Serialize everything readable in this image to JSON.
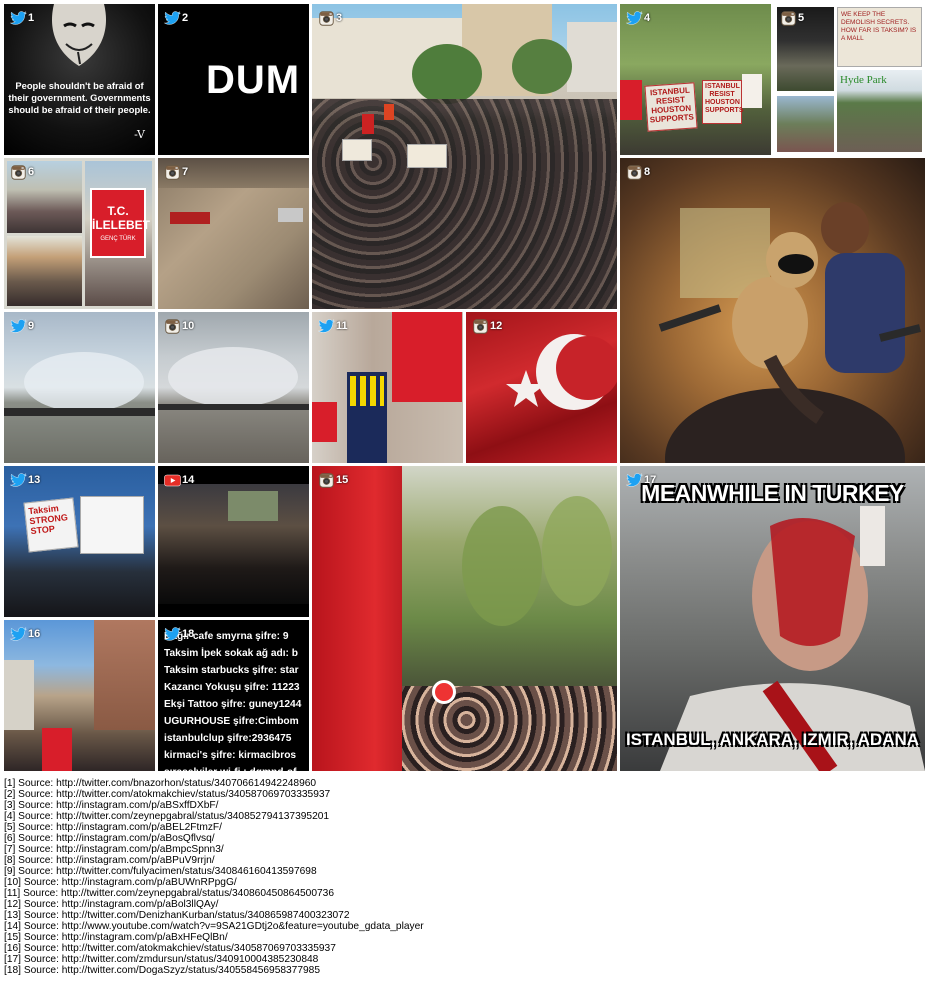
{
  "tiles": [
    {
      "number": "1",
      "source": "twitter",
      "caption": "People shouldn't be afraid of their government. Governments should be afraid of their people.",
      "signature": "-V"
    },
    {
      "number": "2",
      "source": "twitter",
      "caption": "DUM"
    },
    {
      "number": "3",
      "source": "instagram"
    },
    {
      "number": "4",
      "source": "twitter",
      "sign_left": "ISTANBUL RESIST HOUSTON SUPPORTS",
      "sign_right": "ISTANBUL RESIST HOUSTON SUPPORTS"
    },
    {
      "number": "5",
      "source": "instagram",
      "sign_top": "WE KEEP THE DEMOLISH SECRETS. HOW FAR IS TAKSIM? IS A MALL",
      "park_label": "Hyde Park"
    },
    {
      "number": "6",
      "source": "instagram",
      "flag_text": "T.C. İLELEBET",
      "flag_sub": "GENÇ TÜRK"
    },
    {
      "number": "7",
      "source": "instagram"
    },
    {
      "number": "8",
      "source": "instagram"
    },
    {
      "number": "9",
      "source": "twitter"
    },
    {
      "number": "10",
      "source": "instagram"
    },
    {
      "number": "11",
      "source": "twitter"
    },
    {
      "number": "12",
      "source": "instagram"
    },
    {
      "number": "13",
      "source": "twitter",
      "sign": "Taksim STRONG STOP"
    },
    {
      "number": "14",
      "source": "youtube"
    },
    {
      "number": "15",
      "source": "instagram"
    },
    {
      "number": "16",
      "source": "twitter"
    },
    {
      "number": "17",
      "source": "twitter",
      "top_caption": "MEANWHILE IN TURKEY",
      "bottom_caption": "ISTANBUL, ANKARA, IZMIR, ADANA"
    },
    {
      "number": "18",
      "source": "twitter",
      "lines": [
        "Bağir cafe smyrna şifre: 9",
        "Taksim İpek sokak ağ adı: b",
        "Taksim starbucks şifre: star",
        "Kazancı Yokuşu şifre: 11223",
        "Ekşi Tattoo şifre: guney1244",
        "UGURHOUSE şifre:Cimbom",
        "istanbulclup şifre:2936475",
        "kirmaci's şifre: kirmacibros",
        "sıraselviler wi-fi : dgmnd-of"
      ]
    }
  ],
  "sources": [
    "[1] Source: http://twitter.com/bnazorhon/status/340706614942248960",
    "[2] Source: http://twitter.com/atokmakchiev/status/340587069703335937",
    "[3] Source: http://instagram.com/p/aBSxffDXbF/",
    "[4] Source: http://twitter.com/zeynepgabral/status/340852794137395201",
    "[5] Source: http://instagram.com/p/aBEL2FtmzF/",
    "[6] Source: http://instagram.com/p/aBosQflvsq/",
    "[7] Source: http://instagram.com/p/aBmpcSpnn3/",
    "[8] Source: http://instagram.com/p/aBPuV9rrjn/",
    "[9] Source: http://twitter.com/fulyacimen/status/340846160413597698",
    "[10] Source: http://instagram.com/p/aBUWnRPpgG/",
    "[11] Source: http://twitter.com/zeynepgabral/status/340860450864500736",
    "[12] Source: http://instagram.com/p/aBol3llQAy/",
    "[13] Source: http://twitter.com/DenizhanKurban/status/340865987400323072",
    "[14] Source: http://www.youtube.com/watch?v=9SA21GDtj2o&feature=youtube_gdata_player",
    "[15] Source: http://instagram.com/p/aBxHFeQlBn/",
    "[16] Source: http://twitter.com/atokmakchiev/status/340587069703335937",
    "[17] Source: http://twitter.com/zmdursun/status/340910004385230848",
    "[18] Source: http://twitter.com/DogaSzyz/status/340558456958377985"
  ],
  "colors": {
    "twitter": "#1da1f2",
    "instagram": "#8a6a4a",
    "youtube": "#e52d27",
    "turkey_red": "#d81e2a"
  }
}
